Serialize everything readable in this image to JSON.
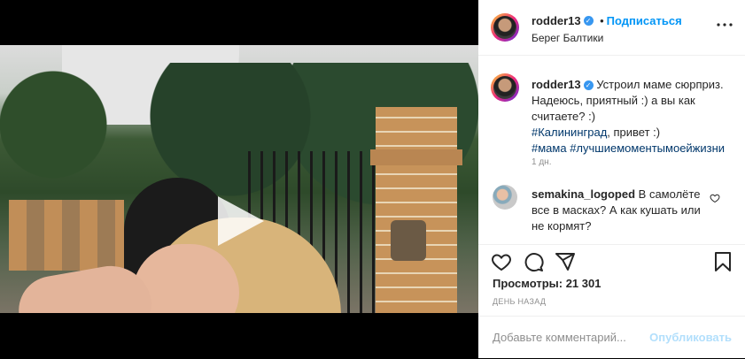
{
  "post": {
    "username": "rodder13",
    "follow_label": "Подписаться",
    "separator": "•",
    "location": "Берег Балтики",
    "caption_text": "Устроил маме сюрприз. Надеюсь, приятный :) а вы как считаете? :)",
    "hashtag_1": "#Калининград",
    "hashtag_1_suffix": ", привет :)",
    "hashtag_2": "#мама",
    "hashtag_3": "#лучшиемоментымоейжизни",
    "time_ago": "1 дн.",
    "views_label": "Просмотры: 21 301",
    "date_label": "ДЕНЬ НАЗАД"
  },
  "comment": {
    "username": "semakina_logoped",
    "text": "В самолёте все в масках? А как кушать или не кормят?"
  },
  "add_comment": {
    "placeholder": "Добавьте комментарий...",
    "publish_label": "Опубликовать"
  },
  "icons": {
    "verified": "verified-badge-icon",
    "more": "more-options-icon",
    "play": "play-icon",
    "like": "heart-icon",
    "comment": "comment-icon",
    "share": "share-icon",
    "save": "bookmark-icon"
  },
  "colors": {
    "accent": "#0095f6",
    "text": "#262626",
    "muted": "#8e8e8e",
    "hashtag": "#00376b",
    "publish_disabled": "#b2dffc"
  }
}
